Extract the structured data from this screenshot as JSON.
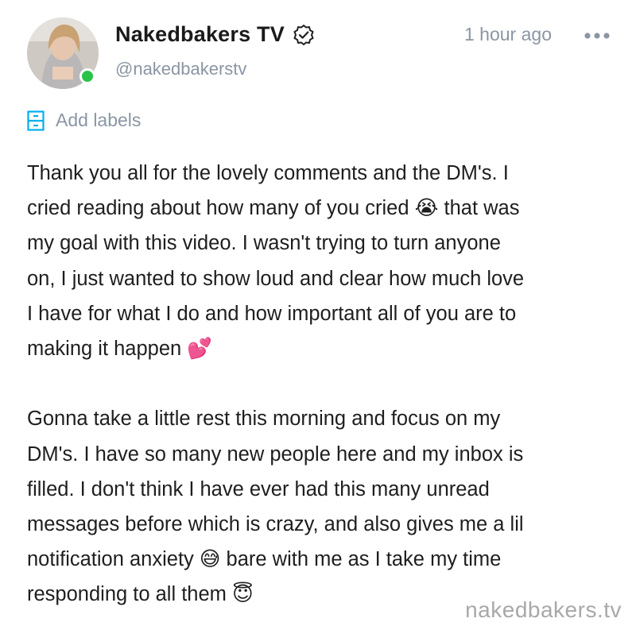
{
  "post": {
    "author": {
      "display_name": "Nakedbakers TV",
      "handle": "@nakedbakerstv",
      "verified": true,
      "online": true
    },
    "timestamp": "1 hour ago",
    "add_labels": "Add labels",
    "body": {
      "lines": [
        "Thank you all for the lovely comments and the DM's. I",
        "cried reading about how many of you cried 😭 that was",
        "my goal with this video. I wasn't trying to turn anyone",
        "on, I just wanted to show loud and clear how much love",
        "I have for what I do and how important all of you are to",
        "making it happen 💕",
        "",
        "Gonna take a little rest this morning and focus on my",
        "DM's. I have so many new people here and my inbox is",
        "filled. I don't think I have ever had this many unread",
        "messages before which is crazy, and also gives me a lil",
        "notification anxiety 😅 bare with me as I take my time",
        "responding to all them 😇"
      ]
    },
    "watermark": "nakedbakers.tv"
  },
  "colors": {
    "accent_muted": "#8a96a3",
    "online": "#2bc24a",
    "label_icon": "#00aff0"
  },
  "icons": {
    "verified": "verified-badge-icon",
    "more": "more-dots-icon",
    "labels": "label-list-icon"
  }
}
